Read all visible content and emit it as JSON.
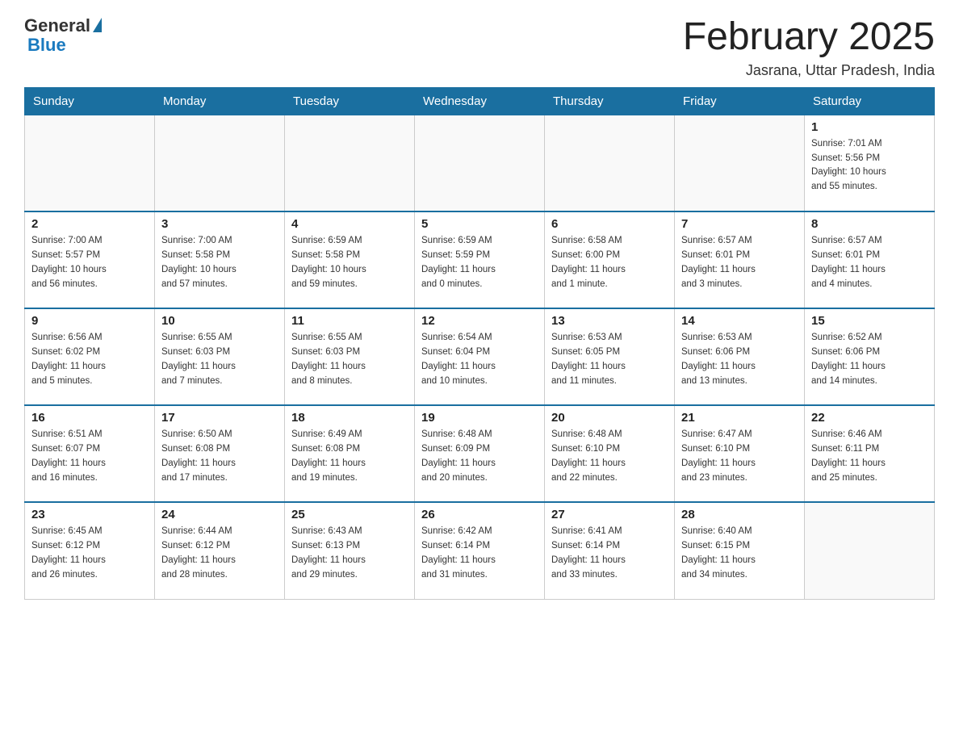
{
  "header": {
    "logo_general": "General",
    "logo_blue": "Blue",
    "month_title": "February 2025",
    "location": "Jasrana, Uttar Pradesh, India"
  },
  "days_of_week": [
    "Sunday",
    "Monday",
    "Tuesday",
    "Wednesday",
    "Thursday",
    "Friday",
    "Saturday"
  ],
  "weeks": [
    [
      {
        "day": "",
        "info": ""
      },
      {
        "day": "",
        "info": ""
      },
      {
        "day": "",
        "info": ""
      },
      {
        "day": "",
        "info": ""
      },
      {
        "day": "",
        "info": ""
      },
      {
        "day": "",
        "info": ""
      },
      {
        "day": "1",
        "info": "Sunrise: 7:01 AM\nSunset: 5:56 PM\nDaylight: 10 hours\nand 55 minutes."
      }
    ],
    [
      {
        "day": "2",
        "info": "Sunrise: 7:00 AM\nSunset: 5:57 PM\nDaylight: 10 hours\nand 56 minutes."
      },
      {
        "day": "3",
        "info": "Sunrise: 7:00 AM\nSunset: 5:58 PM\nDaylight: 10 hours\nand 57 minutes."
      },
      {
        "day": "4",
        "info": "Sunrise: 6:59 AM\nSunset: 5:58 PM\nDaylight: 10 hours\nand 59 minutes."
      },
      {
        "day": "5",
        "info": "Sunrise: 6:59 AM\nSunset: 5:59 PM\nDaylight: 11 hours\nand 0 minutes."
      },
      {
        "day": "6",
        "info": "Sunrise: 6:58 AM\nSunset: 6:00 PM\nDaylight: 11 hours\nand 1 minute."
      },
      {
        "day": "7",
        "info": "Sunrise: 6:57 AM\nSunset: 6:01 PM\nDaylight: 11 hours\nand 3 minutes."
      },
      {
        "day": "8",
        "info": "Sunrise: 6:57 AM\nSunset: 6:01 PM\nDaylight: 11 hours\nand 4 minutes."
      }
    ],
    [
      {
        "day": "9",
        "info": "Sunrise: 6:56 AM\nSunset: 6:02 PM\nDaylight: 11 hours\nand 5 minutes."
      },
      {
        "day": "10",
        "info": "Sunrise: 6:55 AM\nSunset: 6:03 PM\nDaylight: 11 hours\nand 7 minutes."
      },
      {
        "day": "11",
        "info": "Sunrise: 6:55 AM\nSunset: 6:03 PM\nDaylight: 11 hours\nand 8 minutes."
      },
      {
        "day": "12",
        "info": "Sunrise: 6:54 AM\nSunset: 6:04 PM\nDaylight: 11 hours\nand 10 minutes."
      },
      {
        "day": "13",
        "info": "Sunrise: 6:53 AM\nSunset: 6:05 PM\nDaylight: 11 hours\nand 11 minutes."
      },
      {
        "day": "14",
        "info": "Sunrise: 6:53 AM\nSunset: 6:06 PM\nDaylight: 11 hours\nand 13 minutes."
      },
      {
        "day": "15",
        "info": "Sunrise: 6:52 AM\nSunset: 6:06 PM\nDaylight: 11 hours\nand 14 minutes."
      }
    ],
    [
      {
        "day": "16",
        "info": "Sunrise: 6:51 AM\nSunset: 6:07 PM\nDaylight: 11 hours\nand 16 minutes."
      },
      {
        "day": "17",
        "info": "Sunrise: 6:50 AM\nSunset: 6:08 PM\nDaylight: 11 hours\nand 17 minutes."
      },
      {
        "day": "18",
        "info": "Sunrise: 6:49 AM\nSunset: 6:08 PM\nDaylight: 11 hours\nand 19 minutes."
      },
      {
        "day": "19",
        "info": "Sunrise: 6:48 AM\nSunset: 6:09 PM\nDaylight: 11 hours\nand 20 minutes."
      },
      {
        "day": "20",
        "info": "Sunrise: 6:48 AM\nSunset: 6:10 PM\nDaylight: 11 hours\nand 22 minutes."
      },
      {
        "day": "21",
        "info": "Sunrise: 6:47 AM\nSunset: 6:10 PM\nDaylight: 11 hours\nand 23 minutes."
      },
      {
        "day": "22",
        "info": "Sunrise: 6:46 AM\nSunset: 6:11 PM\nDaylight: 11 hours\nand 25 minutes."
      }
    ],
    [
      {
        "day": "23",
        "info": "Sunrise: 6:45 AM\nSunset: 6:12 PM\nDaylight: 11 hours\nand 26 minutes."
      },
      {
        "day": "24",
        "info": "Sunrise: 6:44 AM\nSunset: 6:12 PM\nDaylight: 11 hours\nand 28 minutes."
      },
      {
        "day": "25",
        "info": "Sunrise: 6:43 AM\nSunset: 6:13 PM\nDaylight: 11 hours\nand 29 minutes."
      },
      {
        "day": "26",
        "info": "Sunrise: 6:42 AM\nSunset: 6:14 PM\nDaylight: 11 hours\nand 31 minutes."
      },
      {
        "day": "27",
        "info": "Sunrise: 6:41 AM\nSunset: 6:14 PM\nDaylight: 11 hours\nand 33 minutes."
      },
      {
        "day": "28",
        "info": "Sunrise: 6:40 AM\nSunset: 6:15 PM\nDaylight: 11 hours\nand 34 minutes."
      },
      {
        "day": "",
        "info": ""
      }
    ]
  ]
}
